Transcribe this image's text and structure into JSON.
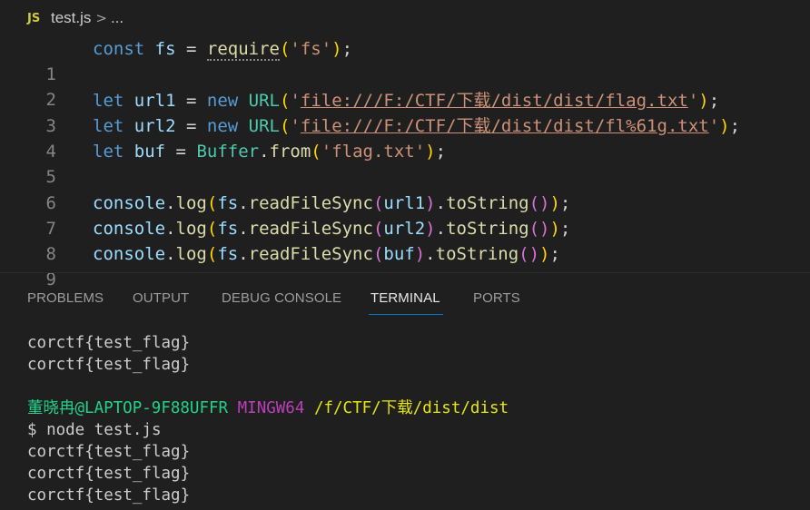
{
  "breadcrumb": {
    "file_icon": "JS",
    "file_name": "test.js",
    "separator": ">",
    "more": "..."
  },
  "editor": {
    "line_numbers": [
      "1",
      "2",
      "3",
      "4",
      "5",
      "6",
      "7",
      "8",
      "9"
    ],
    "lines": [
      [
        "const",
        " ",
        "fs",
        " = ",
        "require",
        "(",
        "'fs'",
        ")",
        ";"
      ],
      [],
      [
        "let",
        " ",
        "url1",
        " = ",
        "new",
        " ",
        "URL",
        "(",
        "'",
        "file:///F:/CTF/下载/dist/dist/flag.txt",
        "'",
        ")",
        ";"
      ],
      [
        "let",
        " ",
        "url2",
        " = ",
        "new",
        " ",
        "URL",
        "(",
        "'",
        "file:///F:/CTF/下载/dist/dist/fl%61g.txt",
        "'",
        ")",
        ";"
      ],
      [
        "let",
        " ",
        "buf",
        " = ",
        "Buffer",
        ".",
        "from",
        "(",
        "'flag.txt'",
        ")",
        ";"
      ],
      [],
      [
        "console",
        ".",
        "log",
        "(",
        "fs",
        ".",
        "readFileSync",
        "(",
        "url1",
        ")",
        ".",
        "toString",
        "()",
        ")",
        ";"
      ],
      [
        "console",
        ".",
        "log",
        "(",
        "fs",
        ".",
        "readFileSync",
        "(",
        "url2",
        ")",
        ".",
        "toString",
        "()",
        ")",
        ";"
      ],
      [
        "console",
        ".",
        "log",
        "(",
        "fs",
        ".",
        "readFileSync",
        "(",
        "buf",
        ")",
        ".",
        "toString",
        "()",
        ")",
        ";"
      ]
    ]
  },
  "panel": {
    "tabs": [
      "PROBLEMS",
      "OUTPUT",
      "DEBUG CONSOLE",
      "TERMINAL",
      "PORTS"
    ],
    "active_tab": "TERMINAL"
  },
  "terminal": {
    "output_before": [
      "corctf{test_flag}",
      "corctf{test_flag}"
    ],
    "prompt": {
      "user": "董晓冉@LAPTOP-9F88UFFR",
      "env": "MINGW64",
      "path": "/f/CTF/下载/dist/dist"
    },
    "command": "$ node test.js",
    "output_after": [
      "corctf{test_flag}",
      "corctf{test_flag}",
      "corctf{test_flag}"
    ]
  },
  "colors": {
    "background": "#1f1f1f",
    "keyword": "#569cd6",
    "variable": "#9cdcfe",
    "function": "#dcdcaa",
    "class": "#4ec9b0",
    "string": "#ce9178",
    "bracket_level1": "#ffd700",
    "bracket_level2": "#da70d6",
    "bracket_level3": "#179fff",
    "tab_active_underline": "#0078d4",
    "terminal_user": "#23d18b",
    "terminal_env": "#bc3fbc",
    "terminal_path": "#e5e510"
  }
}
